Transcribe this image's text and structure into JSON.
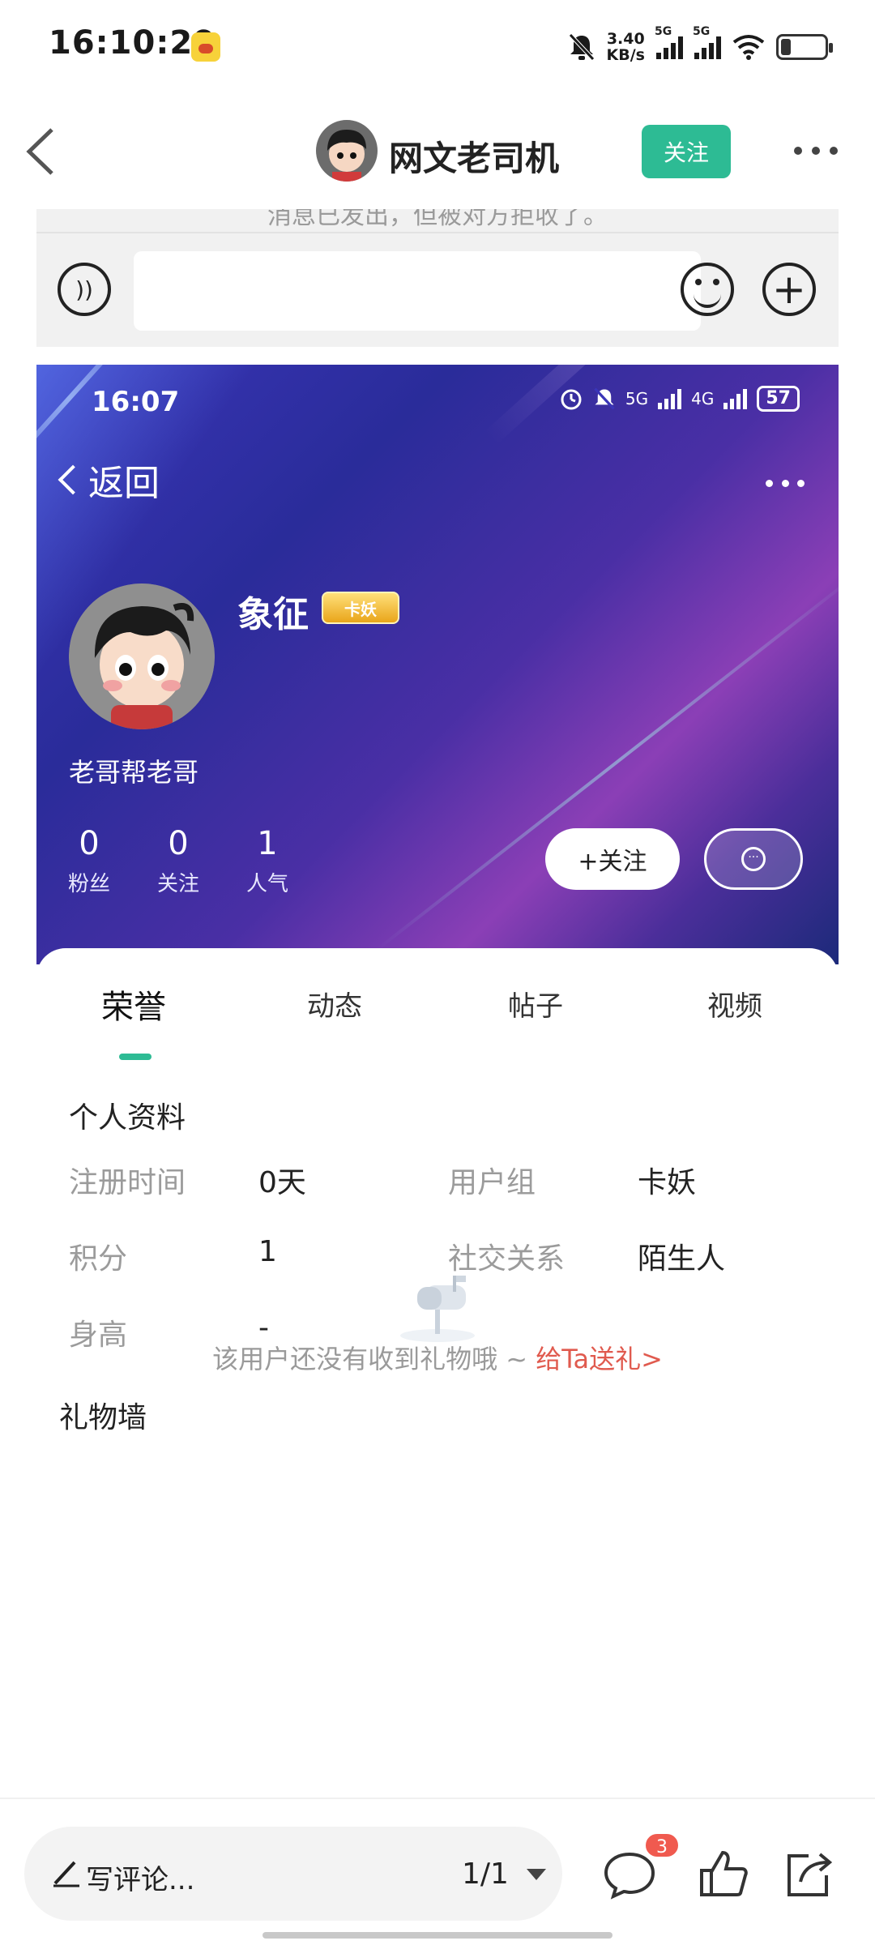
{
  "status_bar": {
    "time": "16:10:29",
    "speed_value": "3.40",
    "speed_unit": "KB/s",
    "sim1": "5G",
    "sim2": "5G"
  },
  "header": {
    "title": "网文老司机",
    "follow_label": "关注"
  },
  "chat": {
    "notice": "消息已发出，但被对方拒收了。"
  },
  "profile": {
    "status_time": "16:07",
    "status_net1": "5G",
    "status_net2": "4G",
    "battery": "57",
    "back_label": "返回",
    "name": "象征",
    "badge": "卡妖",
    "signature": "老哥帮老哥",
    "stats": [
      {
        "value": "0",
        "label": "粉丝"
      },
      {
        "value": "0",
        "label": "关注"
      },
      {
        "value": "1",
        "label": "人气"
      }
    ],
    "follow_button": "+关注",
    "tabs": [
      "荣誉",
      "动态",
      "帖子",
      "视频"
    ],
    "active_tab": "荣誉",
    "info_title": "个人资料",
    "info": [
      {
        "label": "注册时间",
        "value": "0天"
      },
      {
        "label": "用户组",
        "value": "卡妖"
      },
      {
        "label": "积分",
        "value": "1"
      },
      {
        "label": "社交关系",
        "value": "陌生人"
      },
      {
        "label": "身高",
        "value": "-"
      }
    ],
    "gift_title": "礼物墙",
    "gift_empty": "该用户还没有收到礼物哦 ~",
    "gift_link": "给Ta送礼>"
  },
  "bottom": {
    "comment_placeholder": "写评论...",
    "page": "1/1",
    "comment_count": "3"
  },
  "colors": {
    "accent": "#2dbb94",
    "badge_red": "#f05a4f",
    "link_red": "#e05a4e"
  }
}
